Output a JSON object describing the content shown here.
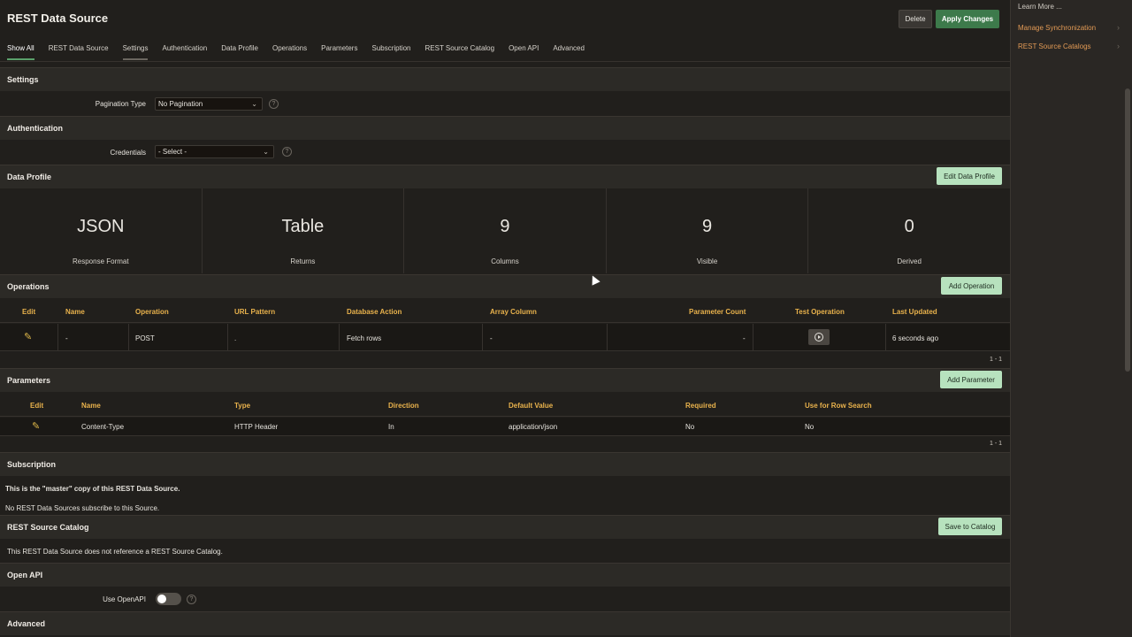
{
  "page": {
    "title": "REST Data Source",
    "delete_label": "Delete",
    "apply_label": "Apply Changes"
  },
  "tabs": [
    {
      "label": "Show All"
    },
    {
      "label": "REST Data Source"
    },
    {
      "label": "Settings"
    },
    {
      "label": "Authentication"
    },
    {
      "label": "Data Profile"
    },
    {
      "label": "Operations"
    },
    {
      "label": "Parameters"
    },
    {
      "label": "Subscription"
    },
    {
      "label": "REST Source Catalog"
    },
    {
      "label": "Open API"
    },
    {
      "label": "Advanced"
    }
  ],
  "right_panel": {
    "learn_more": "Learn More ...",
    "links": [
      "Manage Synchronization",
      "REST Source Catalogs"
    ]
  },
  "settings": {
    "header": "Settings",
    "pagination_label": "Pagination Type",
    "pagination_value": "No Pagination"
  },
  "authentication": {
    "header": "Authentication",
    "credentials_label": "Credentials",
    "credentials_value": "- Select -"
  },
  "data_profile": {
    "header": "Data Profile",
    "edit_label": "Edit Data Profile",
    "stats": [
      {
        "value": "JSON",
        "caption": "Response Format"
      },
      {
        "value": "Table",
        "caption": "Returns"
      },
      {
        "value": "9",
        "caption": "Columns"
      },
      {
        "value": "9",
        "caption": "Visible"
      },
      {
        "value": "0",
        "caption": "Derived"
      }
    ]
  },
  "operations": {
    "header": "Operations",
    "add_label": "Add Operation",
    "columns": [
      "Edit",
      "Name",
      "Operation",
      "URL Pattern",
      "Database Action",
      "Array Column",
      "Parameter Count",
      "Test Operation",
      "Last Updated"
    ],
    "rows": [
      {
        "name": "-",
        "operation": "POST",
        "url_pattern": ".",
        "database_action": "Fetch rows",
        "array_column": "-",
        "parameter_count": "-",
        "last_updated": "6 seconds ago"
      }
    ],
    "pager": "1 - 1"
  },
  "parameters": {
    "header": "Parameters",
    "add_label": "Add Parameter",
    "columns": [
      "Edit",
      "Name",
      "Type",
      "Direction",
      "Default Value",
      "Required",
      "Use for Row Search"
    ],
    "rows": [
      {
        "name": "Content-Type",
        "type": "HTTP Header",
        "direction": "In",
        "default_value": "application/json",
        "required": "No",
        "row_search": "No"
      }
    ],
    "pager": "1 - 1"
  },
  "subscription": {
    "header": "Subscription",
    "line1": "This is the \"master\" copy of this REST Data Source.",
    "line2": "No REST Data Sources subscribe to this Source."
  },
  "catalog": {
    "header": "REST Source Catalog",
    "save_label": "Save to Catalog",
    "text": "This REST Data Source does not reference a REST Source Catalog."
  },
  "open_api": {
    "header": "Open API",
    "use_label": "Use OpenAPI",
    "use_value": false
  },
  "advanced": {
    "header": "Advanced"
  },
  "colors": {
    "accent_green": "#3d7a4b",
    "light_green_button": "#b7e2be",
    "column_header": "#e9b24c",
    "link": "#e29a55"
  }
}
